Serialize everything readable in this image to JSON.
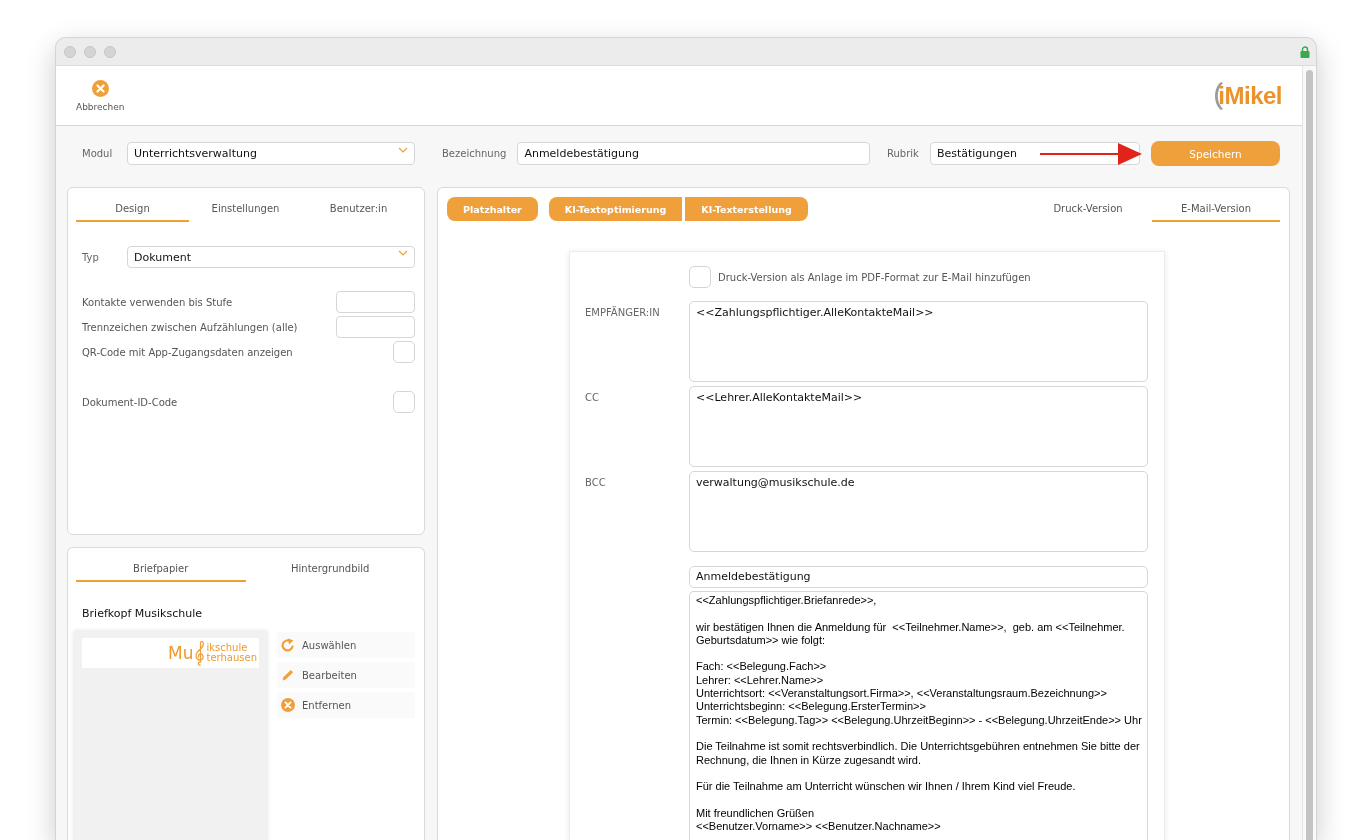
{
  "toolbar": {
    "cancel_button": {
      "label": "Abbrechen"
    },
    "logo": "iMikel"
  },
  "header_fields": [
    {
      "label": "Modul",
      "value": "Unterrichtsverwaltung",
      "kind": "select"
    },
    {
      "label": "Bezeichnung",
      "value": "Anmeldebestätigung",
      "kind": "text"
    },
    {
      "label": "Rubrik",
      "value": "Bestätigungen",
      "kind": "text"
    }
  ],
  "save_button": {
    "label": "Speichern"
  },
  "settings_panel": {
    "tabs": [
      {
        "label": "Design",
        "selected": true
      },
      {
        "label": "Einstellungen",
        "selected": false
      },
      {
        "label": "Benutzer:in",
        "selected": false
      }
    ],
    "type_field": {
      "label": "Typ",
      "value": "Dokument",
      "kind": "select"
    },
    "option_groups": [
      [
        {
          "label": "Kontakte verwenden bis Stufe",
          "kind": "text"
        },
        {
          "label": "Trennzeichen zwischen Aufzählungen (alle)",
          "kind": "text"
        },
        {
          "label": "QR-Code mit App-Zugangsdaten anzeigen",
          "kind": "checkbox",
          "checked": false
        }
      ],
      [
        {
          "label": "Dokument-ID-Code",
          "kind": "checkbox",
          "checked": false
        }
      ]
    ]
  },
  "letterhead_panel": {
    "tabs": [
      {
        "label": "Briefpapier",
        "selected": true
      },
      {
        "label": "Hintergrundbild",
        "selected": false
      }
    ],
    "title": "Briefkopf Musikschule",
    "preview": {
      "logo_lead": "Mu",
      "logo_line_1": "ikschule",
      "logo_line_2": "terhausen"
    },
    "actions": [
      {
        "label": "Auswählen",
        "kind": "replace"
      },
      {
        "label": "Bearbeiten",
        "kind": "edit"
      },
      {
        "label": "Entfernen",
        "kind": "remove"
      }
    ]
  },
  "editor_panel": {
    "tool_groups": [
      [
        "Platzhalter"
      ],
      [
        "KI-Textoptimierung",
        "KI-Texterstellung"
      ]
    ],
    "version_tabs": [
      {
        "label": "Druck-Version",
        "selected": false
      },
      {
        "label": "E-Mail-Version",
        "selected": true
      }
    ],
    "email": {
      "attach_pdf": {
        "label": "Druck-Version als Anlage im PDF-Format zur E-Mail hinzufügen",
        "checked": false
      },
      "address_fields": [
        {
          "label": "EMPFÄNGER:IN",
          "value": "<<Zahlungspflichtiger.AlleKontakteMail>>"
        },
        {
          "label": "CC",
          "value": "<<Lehrer.AlleKontakteMail>>"
        },
        {
          "label": "BCC",
          "value": "verwaltung@musikschule.de"
        }
      ],
      "subject": "Anmeldebestätigung",
      "body": [
        [
          "<<Zahlungspflichtiger.Briefanrede>>,"
        ],
        [
          "wir bestätigen Ihnen die Anmeldung für  <<Teilnehmer.Name>>,  geb. am <<Teilnehmer.",
          "Geburtsdatum>> wie folgt:"
        ],
        [
          "Fach: <<Belegung.Fach>>",
          "Lehrer: <<Lehrer.Name>>",
          "Unterrichtsort: <<Veranstaltungsort.Firma>>, <<Veranstaltungsraum.Bezeichnung>>",
          "Unterrichtsbeginn: <<Belegung.ErsterTermin>>",
          "Termin: <<Belegung.Tag>> <<Belegung.UhrzeitBeginn>> - <<Belegung.UhrzeitEnde>> Uhr"
        ],
        [
          "Die Teilnahme ist somit rechtsverbindlich. Die Unterrichtsgebühren entnehmen Sie bitte der",
          "Rechnung, die Ihnen in Kürze zugesandt wird."
        ],
        [
          "Für die Teilnahme am Unterricht wünschen wir Ihnen / Ihrem Kind viel Freude."
        ],
        [
          "Mit freundlichen Grüßen",
          "<<Benutzer.Vorname>> <<Benutzer.Nachname>>"
        ]
      ]
    }
  }
}
